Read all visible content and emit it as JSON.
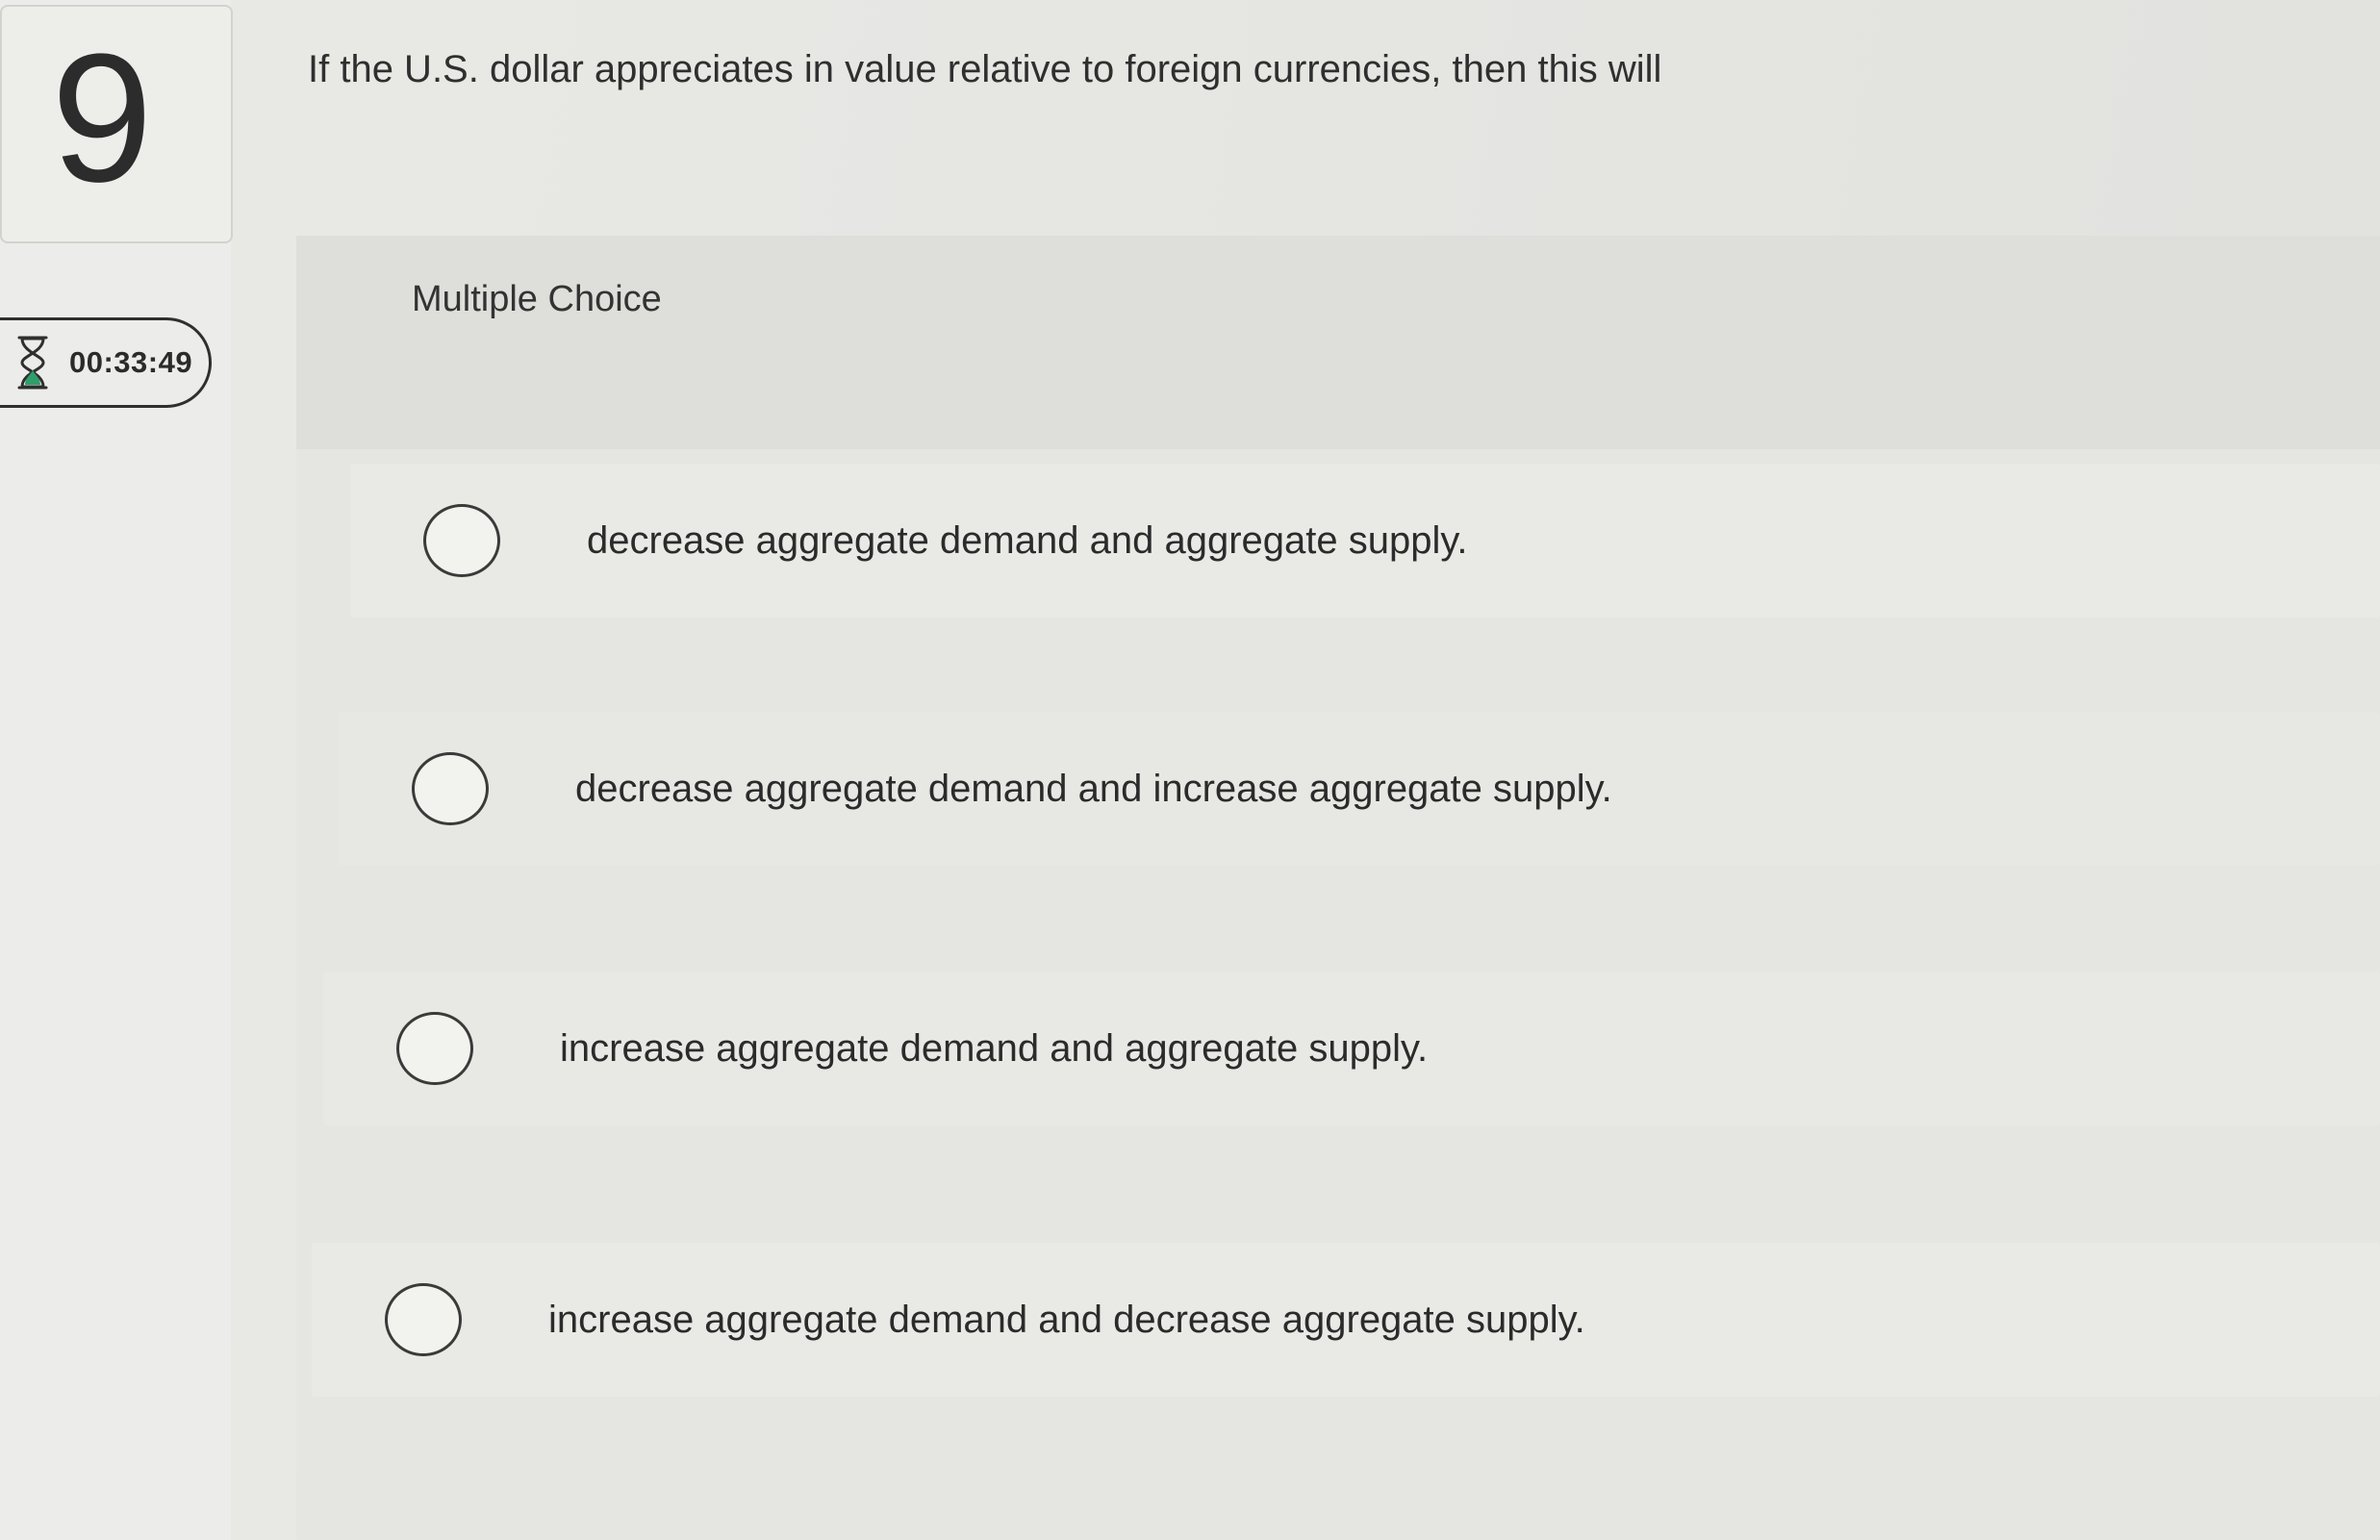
{
  "question": {
    "number": "9",
    "prompt": "If the U.S. dollar appreciates in value relative to foreign currencies, then this will",
    "type_label": "Multiple Choice"
  },
  "timer": {
    "icon": "hourglass-icon",
    "value": "00:33:49"
  },
  "options": [
    {
      "label": "decrease aggregate demand and aggregate supply.",
      "selected": false
    },
    {
      "label": "decrease aggregate demand and increase aggregate supply.",
      "selected": false
    },
    {
      "label": "increase aggregate demand and aggregate supply.",
      "selected": false
    },
    {
      "label": "increase aggregate demand and decrease aggregate supply.",
      "selected": false
    }
  ],
  "colors": {
    "timer_icon_accent": "#2e9e6a",
    "text": "#2b2b2b"
  }
}
